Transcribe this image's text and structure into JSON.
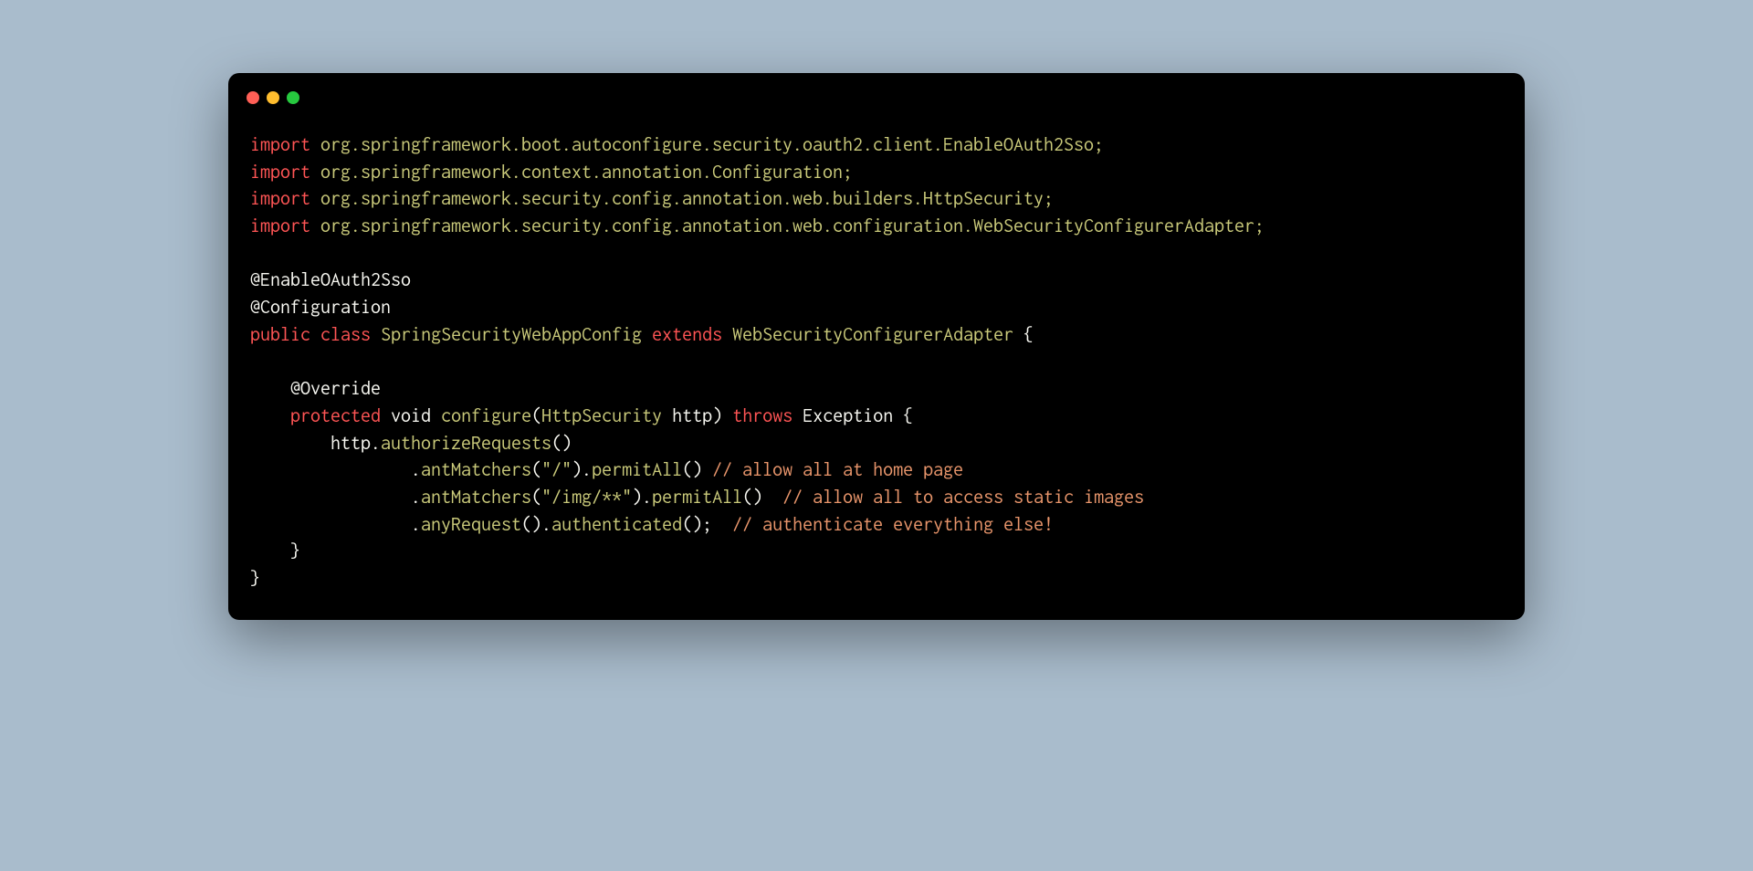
{
  "window": {
    "colors": {
      "red": "#ff5f56",
      "yellow": "#ffbd2e",
      "green": "#27c93f"
    }
  },
  "code": {
    "line1": {
      "kw_import": "import",
      "rest": " org.springframework.boot.autoconfigure.security.oauth2.client.EnableOAuth2Sso;"
    },
    "line2": {
      "kw_import": "import",
      "rest": " org.springframework.context.annotation.Configuration;"
    },
    "line3": {
      "kw_import": "import",
      "rest": " org.springframework.security.config.annotation.web.builders.HttpSecurity;"
    },
    "line4": {
      "kw_import": "import",
      "rest": " org.springframework.security.config.annotation.web.configuration.WebSecurityConfigurerAdapter;"
    },
    "line6": {
      "annotation": "@EnableOAuth2Sso"
    },
    "line7": {
      "annotation": "@Configuration"
    },
    "line8": {
      "kw_public": "public",
      "sp1": " ",
      "kw_class": "class",
      "sp2": " ",
      "classname": "SpringSecurityWebAppConfig",
      "sp3": " ",
      "kw_extends": "extends",
      "sp4": " ",
      "supertype": "WebSecurityConfigurerAdapter",
      "brace": " {"
    },
    "line10": {
      "indent": "    ",
      "annotation": "@Override"
    },
    "line11": {
      "indent": "    ",
      "kw_protected": "protected",
      "sp1": " ",
      "kw_void": "void",
      "sp2": " ",
      "method": "configure",
      "open": "(",
      "paramtype": "HttpSecurity",
      "sp3": " ",
      "paramname": "http",
      "close": ")",
      "sp4": " ",
      "kw_throws": "throws",
      "sp5": " ",
      "exception": "Exception",
      "brace": " {"
    },
    "line12": {
      "indent": "        ",
      "obj": "http",
      "dot": ".",
      "method": "authorizeRequests",
      "parens": "()"
    },
    "line13": {
      "indent": "                ",
      "dot": ".",
      "method1": "antMatchers",
      "open1": "(",
      "str1": "\"/\"",
      "close1": ")",
      "dot2": ".",
      "method2": "permitAll",
      "parens2": "()",
      "sp": " ",
      "comment": "// allow all at home page"
    },
    "line14": {
      "indent": "                ",
      "dot": ".",
      "method1": "antMatchers",
      "open1": "(",
      "str1": "\"/img/**\"",
      "close1": ")",
      "dot2": ".",
      "method2": "permitAll",
      "parens2": "()",
      "sp": "  ",
      "comment": "// allow all to access static images"
    },
    "line15": {
      "indent": "                ",
      "dot": ".",
      "method1": "anyRequest",
      "parens1": "()",
      "dot2": ".",
      "method2": "authenticated",
      "parens2": "();",
      "sp": "  ",
      "comment": "// authenticate everything else!"
    },
    "line16": {
      "indent": "    ",
      "brace": "}"
    },
    "line17": {
      "brace": "}"
    }
  }
}
